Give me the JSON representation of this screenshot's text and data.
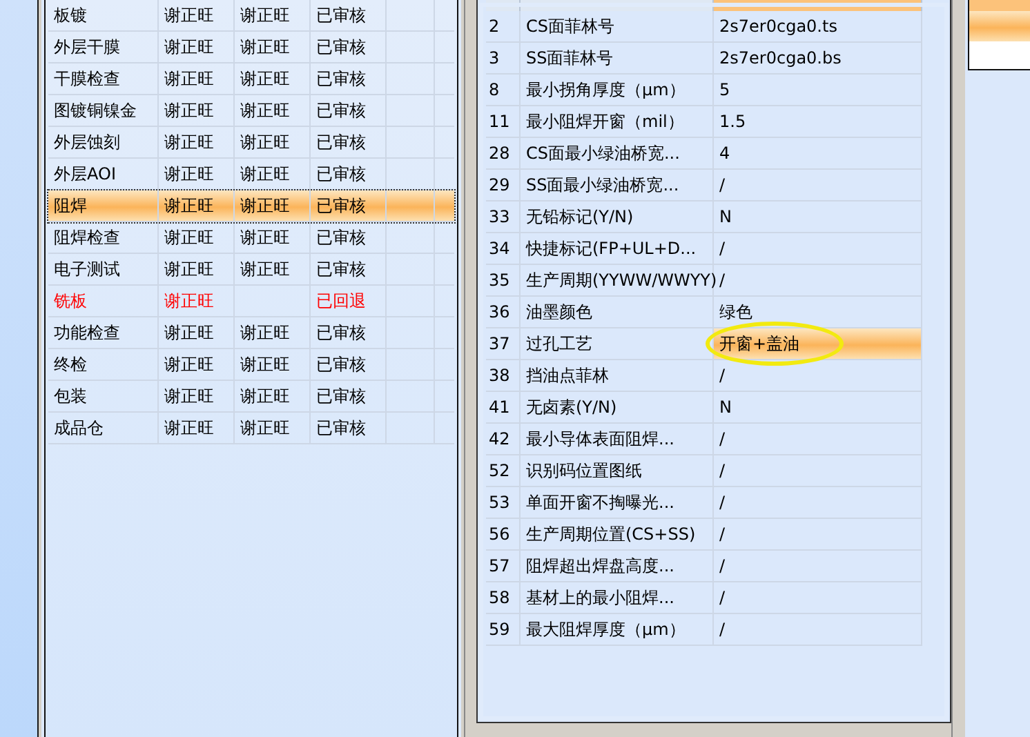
{
  "process_table": {
    "rows": [
      {
        "cells": [
          "板镀",
          "谢正旺",
          "谢正旺",
          "已审核"
        ],
        "returned": false,
        "selected": false
      },
      {
        "cells": [
          "外层干膜",
          "谢正旺",
          "谢正旺",
          "已审核"
        ],
        "returned": false,
        "selected": false
      },
      {
        "cells": [
          "干膜检查",
          "谢正旺",
          "谢正旺",
          "已审核"
        ],
        "returned": false,
        "selected": false
      },
      {
        "cells": [
          "图镀铜镍金",
          "谢正旺",
          "谢正旺",
          "已审核"
        ],
        "returned": false,
        "selected": false
      },
      {
        "cells": [
          "外层蚀刻",
          "谢正旺",
          "谢正旺",
          "已审核"
        ],
        "returned": false,
        "selected": false
      },
      {
        "cells": [
          "外层AOI",
          "谢正旺",
          "谢正旺",
          "已审核"
        ],
        "returned": false,
        "selected": false
      },
      {
        "cells": [
          "阻焊",
          "谢正旺",
          "谢正旺",
          "已审核"
        ],
        "returned": false,
        "selected": true
      },
      {
        "cells": [
          "阻焊检查",
          "谢正旺",
          "谢正旺",
          "已审核"
        ],
        "returned": false,
        "selected": false
      },
      {
        "cells": [
          "电子测试",
          "谢正旺",
          "谢正旺",
          "已审核"
        ],
        "returned": false,
        "selected": false
      },
      {
        "cells": [
          "铣板",
          "谢正旺",
          "",
          "已回退"
        ],
        "returned": true,
        "selected": false
      },
      {
        "cells": [
          "功能检查",
          "谢正旺",
          "谢正旺",
          "已审核"
        ],
        "returned": false,
        "selected": false
      },
      {
        "cells": [
          "终检",
          "谢正旺",
          "谢正旺",
          "已审核"
        ],
        "returned": false,
        "selected": false
      },
      {
        "cells": [
          "包装",
          "谢正旺",
          "谢正旺",
          "已审核"
        ],
        "returned": false,
        "selected": false
      },
      {
        "cells": [
          "成品仓",
          "谢正旺",
          "谢正旺",
          "已审核"
        ],
        "returned": false,
        "selected": false
      }
    ]
  },
  "param_table": {
    "rows": [
      {
        "no": "2",
        "item": "CS面菲林号",
        "value": "2s7er0cga0.ts",
        "selected": false
      },
      {
        "no": "3",
        "item": "SS面菲林号",
        "value": "2s7er0cga0.bs",
        "selected": false
      },
      {
        "no": "8",
        "item": "最小拐角厚度（μm）",
        "value": "5",
        "selected": false
      },
      {
        "no": "11",
        "item": "最小阻焊开窗（mil）",
        "value": "1.5",
        "selected": false
      },
      {
        "no": "28",
        "item": "CS面最小绿油桥宽...",
        "value": "4",
        "selected": false
      },
      {
        "no": "29",
        "item": "SS面最小绿油桥宽...",
        "value": "/",
        "selected": false
      },
      {
        "no": "33",
        "item": "无铅标记(Y/N)",
        "value": "N",
        "selected": false
      },
      {
        "no": "34",
        "item": "快捷标记(FP+UL+D...",
        "value": "/",
        "selected": false
      },
      {
        "no": "35",
        "item": "生产周期(YYWW/WWYY)",
        "value": "/",
        "selected": false
      },
      {
        "no": "36",
        "item": "油墨颜色",
        "value": "绿色",
        "selected": false
      },
      {
        "no": "37",
        "item": "过孔工艺",
        "value": "开窗+盖油",
        "selected": true
      },
      {
        "no": "38",
        "item": "挡油点菲林",
        "value": "/",
        "selected": false
      },
      {
        "no": "41",
        "item": "无卤素(Y/N)",
        "value": "N",
        "selected": false
      },
      {
        "no": "42",
        "item": "最小导体表面阻焊...",
        "value": "/",
        "selected": false
      },
      {
        "no": "52",
        "item": "识别码位置图纸",
        "value": "/",
        "selected": false
      },
      {
        "no": "53",
        "item": "单面开窗不掏曝光...",
        "value": "/",
        "selected": false
      },
      {
        "no": "56",
        "item": "生产周期位置(CS+SS)",
        "value": "/",
        "selected": false
      },
      {
        "no": "57",
        "item": "阻焊超出焊盘高度...",
        "value": "/",
        "selected": false
      },
      {
        "no": "58",
        "item": "基材上的最小阻焊...",
        "value": "/",
        "selected": false
      },
      {
        "no": "59",
        "item": "最大阻焊厚度（μm）",
        "value": "/",
        "selected": false
      }
    ]
  }
}
